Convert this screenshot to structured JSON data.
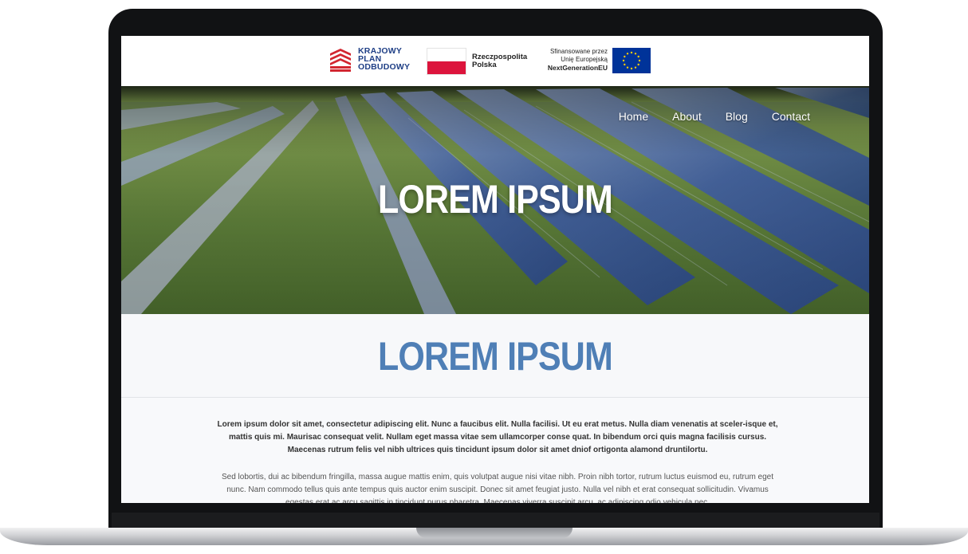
{
  "funding_bar": {
    "kpo_lines": [
      "KRAJOWY",
      "PLAN",
      "ODBUDOWY"
    ],
    "poland_lines": [
      "Rzeczpospolita",
      "Polska"
    ],
    "eu_lines": [
      "Sfinansowane przez",
      "Unię Europejską",
      "NextGenerationEU"
    ]
  },
  "nav": {
    "items": [
      "Home",
      "About",
      "Blog",
      "Contact"
    ]
  },
  "hero": {
    "title": "LOREM IPSUM"
  },
  "section": {
    "title": "LOREM IPSUM"
  },
  "content": {
    "intro": "Lorem ipsum dolor sit amet, consectetur adipiscing elit. Nunc a faucibus elit. Nulla facilisi. Ut eu erat metus. Nulla diam venenatis at sceler-isque et, mattis quis mi. Maurisac consequat velit. Nullam eget massa vitae sem ullamcorper conse quat. In bibendum orci quis magna facilisis cursus. Maecenas rutrum felis vel nibh ultrices quis tincidunt ipsum dolor sit amet dniof ortigonta alamond druntilortu.",
    "body": "Sed lobortis, dui ac bibendum fringilla, massa augue mattis enim, quis volutpat augue nisi vitae nibh. Proin nibh tortor, rutrum luctus euismod eu, rutrum eget nunc. Nam commodo tellus quis ante tempus quis auctor enim suscipit. Donec sit amet feugiat justo. Nulla vel nibh et erat consequat sollicitudin. Vivamus egestas erat ac arcu sagittis in tincidunt purus pharetra. Maecenas viverra suscipit arcu, ac adipiscing odio vehicula nec."
  },
  "colors": {
    "heading_blue": "#4f7fb6",
    "kpo_blue": "#1f3f86",
    "kpo_red": "#d22630",
    "eu_blue": "#003399",
    "eu_gold": "#ffcc00",
    "poland_red": "#dc143c"
  }
}
